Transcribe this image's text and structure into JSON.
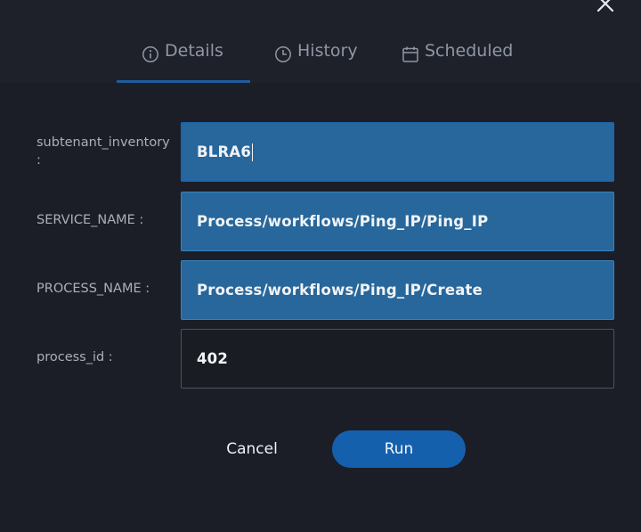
{
  "tabs": [
    {
      "label": "Details",
      "icon": "info-icon",
      "active": true
    },
    {
      "label": "History",
      "icon": "clock-icon",
      "active": false
    },
    {
      "label": "Scheduled",
      "icon": "calendar-icon",
      "active": false
    }
  ],
  "form": {
    "fields": [
      {
        "label": "subtenant_inventory\n:",
        "value": "BLRA6"
      },
      {
        "label": "SERVICE_NAME :",
        "value": "Process/workflows/Ping_IP/Ping_IP"
      },
      {
        "label": "PROCESS_NAME :",
        "value": "Process/workflows/Ping_IP/Create"
      },
      {
        "label": "process_id :",
        "value": "402"
      }
    ]
  },
  "actions": {
    "cancel_label": "Cancel",
    "run_label": "Run"
  },
  "colors": {
    "background": "#1b1e26",
    "header": "#1e212a",
    "field_filled": "#27679b",
    "field_plain": "#191c23",
    "accent": "#1560ad"
  }
}
